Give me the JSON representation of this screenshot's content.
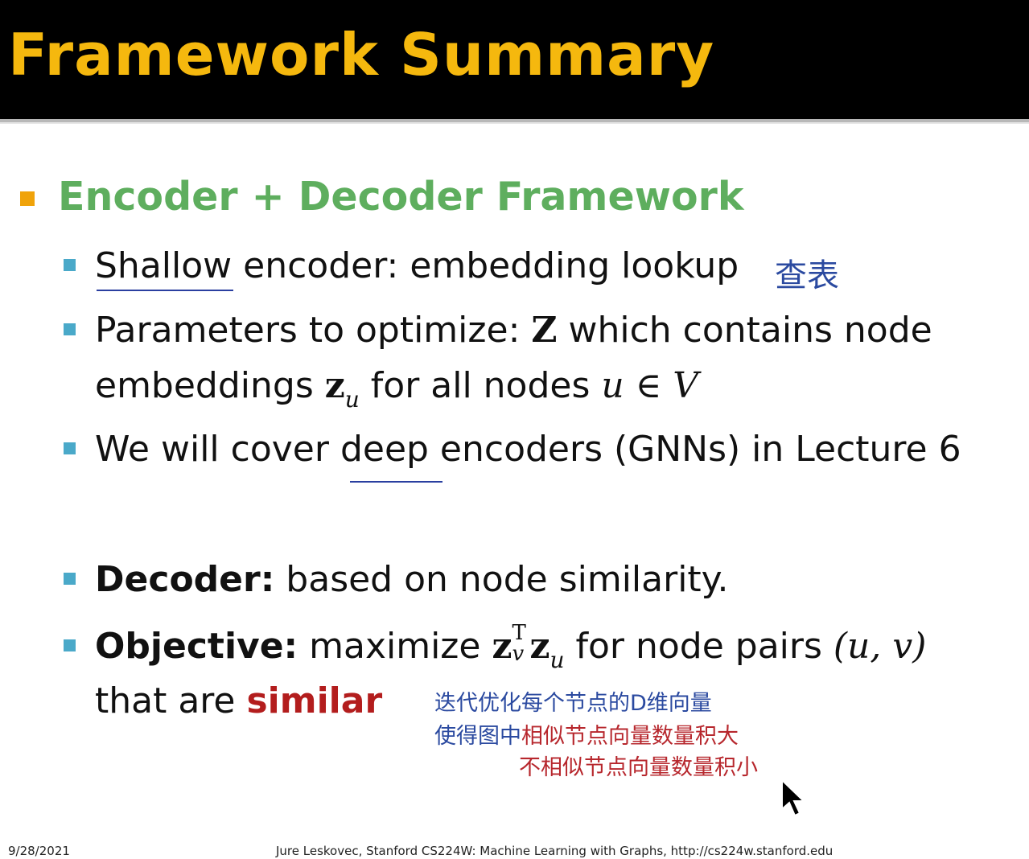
{
  "title": "Framework Summary",
  "heading": "Encoder + Decoder Framework",
  "bullets": {
    "shallow": {
      "underlined": "Shallow",
      "rest": " encoder: embedding lookup"
    },
    "params": {
      "line1_text": "Parameters to optimize: ",
      "line1_math": "Z",
      "line1_rest": " which contains node",
      "line2_text": "embeddings ",
      "line2_z": "z",
      "line2_sub": "u",
      "line2_rest": " for all nodes ",
      "line2_u": "u",
      "line2_in": " ∈ ",
      "line2_V": "V"
    },
    "deep": {
      "pre": "We will cover ",
      "underlined": "deep",
      "post": " encoders (GNNs) in Lecture 6"
    },
    "decoder": {
      "bold": "Decoder:",
      "rest": " based on node similarity."
    },
    "objective": {
      "bold": "Objective:",
      "text": " maximize ",
      "z1": "z",
      "sup": "T",
      "sub1": "v",
      "z2": "z",
      "sub2": "u",
      "rest": " for node pairs ",
      "pair": "(u, v)",
      "line2": "that are ",
      "similar": "similar"
    }
  },
  "annotations": {
    "lookup": "查表",
    "line1": "迭代优化每个节点的D维向量",
    "line2_blue": "使得图中",
    "line2_red": "相似节点向量数量积大",
    "line3": "不相似节点向量数量积小"
  },
  "footer": {
    "date": "9/28/2021",
    "credit": "Jure Leskovec, Stanford CS224W: Machine Learning with Graphs, http://cs224w.stanford.edu"
  },
  "colors": {
    "title": "#f5b80e",
    "heading": "#5eae5e",
    "bullet1": "#f0a30a",
    "bullet2": "#4aa9c9",
    "similar": "#b31d1d",
    "ink_blue": "#2b4aa0",
    "ink_red": "#b7272d"
  }
}
